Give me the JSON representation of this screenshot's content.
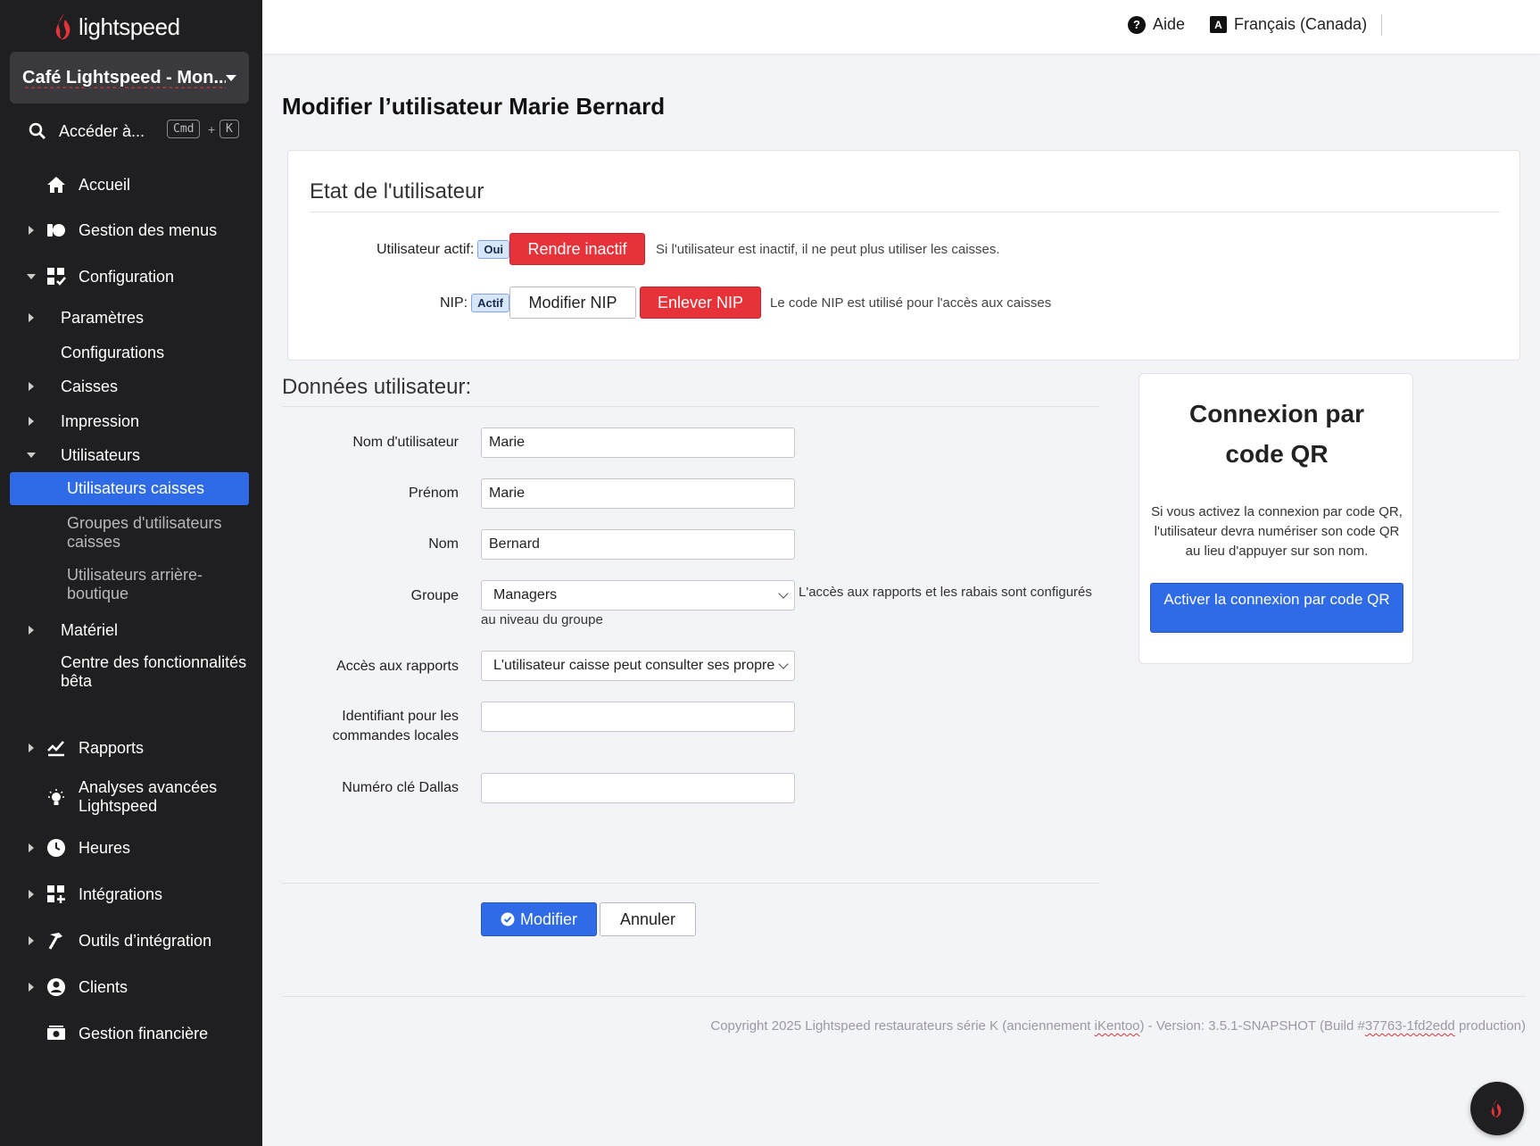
{
  "brand": {
    "name": "lightspeed",
    "accent": "#e8323a"
  },
  "sidebar": {
    "store": "Café Lightspeed - Mon...",
    "search_label": "Accéder à...",
    "shortcut": [
      "Cmd",
      "+",
      "K"
    ],
    "items": [
      {
        "label": "Accueil",
        "icon": "home-icon"
      },
      {
        "label": "Gestion des menus",
        "icon": "menu-icon"
      },
      {
        "label": "Configuration",
        "icon": "configuration-icon"
      },
      {
        "label": "Paramètres"
      },
      {
        "label": "Configurations"
      },
      {
        "label": "Caisses"
      },
      {
        "label": "Impression"
      },
      {
        "label": "Utilisateurs"
      },
      {
        "label": "Utilisateurs caisses"
      },
      {
        "label": "Groupes d'utilisateurs caisses"
      },
      {
        "label": "Utilisateurs arrière-boutique"
      },
      {
        "label": "Matériel"
      },
      {
        "label": "Centre des fonctionnalités bêta"
      },
      {
        "label": "Rapports",
        "icon": "reports-icon"
      },
      {
        "label": "Analyses avancées Lightspeed",
        "icon": "lightbulb-icon"
      },
      {
        "label": "Heures",
        "icon": "clock-icon"
      },
      {
        "label": "Intégrations",
        "icon": "integrations-icon"
      },
      {
        "label": "Outils d’intégration",
        "icon": "hammer-icon"
      },
      {
        "label": "Clients",
        "icon": "user-circle-icon"
      },
      {
        "label": "Gestion financière",
        "icon": "cash-icon"
      }
    ]
  },
  "topbar": {
    "help": "Aide",
    "language": "Français (Canada)"
  },
  "page": {
    "title": "Modifier l’utilisateur Marie Bernard"
  },
  "state": {
    "title": "Etat de l'utilisateur",
    "active_label": "Utilisateur actif:",
    "active_value": "Oui",
    "deactivate_button": "Rendre inactif",
    "deactivate_help": "Si l'utilisateur est inactif, il ne peut plus utiliser les caisses.",
    "pin_label": "NIP:",
    "pin_value": "Actif",
    "modify_pin_button": "Modifier NIP",
    "remove_pin_button": "Enlever NIP",
    "pin_help": "Le code NIP est utilisé pour l'accès aux caisses"
  },
  "form": {
    "title": "Données utilisateur:",
    "username_label": "Nom d'utilisateur",
    "username_value": "Marie",
    "firstname_label": "Prénom",
    "firstname_value": "Marie",
    "lastname_label": "Nom",
    "lastname_value": "Bernard",
    "group_label": "Groupe",
    "group_value": "Managers",
    "group_help_1": "L'accès aux rapports et les rabais sont configurés",
    "group_help_2": "au niveau du groupe",
    "reports_label": "Accès aux rapports",
    "reports_value": "L'utilisateur caisse peut consulter ses propres rapports",
    "local_id_label": "Identifiant pour les commandes locales",
    "local_id_value": "",
    "dallas_label": "Numéro clé Dallas",
    "dallas_value": "",
    "submit_button": "Modifier",
    "cancel_button": "Annuler"
  },
  "qr": {
    "title": "Connexion par code QR",
    "description": "Si vous activez la connexion par code QR, l'utilisateur devra numériser son code QR au lieu d'appuyer sur son nom.",
    "button": "Activer la connexion par code QR"
  },
  "footer": {
    "text_1": "Copyright 2025 Lightspeed restaurateurs série K (anciennement ",
    "brand": "iKentoo",
    "text_2": ") - Version: 3.5.1-SNAPSHOT (Build #",
    "build": "37763-1fd2edd",
    "text_3": " production)"
  }
}
